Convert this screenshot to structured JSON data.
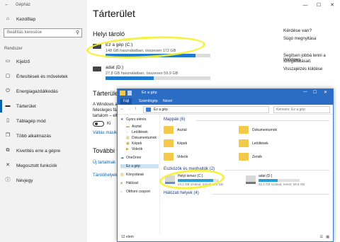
{
  "window": {
    "title": "Gépház"
  },
  "sidebar": {
    "home_label": "Kezdőlap",
    "search_placeholder": "Beállítás keresése",
    "section_label": "Rendszer",
    "items": [
      {
        "label": "Kijelző",
        "icon": "display-icon"
      },
      {
        "label": "Értesítések és műveletek",
        "icon": "notification-icon"
      },
      {
        "label": "Energiagazdálkodás",
        "icon": "power-icon"
      },
      {
        "label": "Tárterület",
        "icon": "storage-icon",
        "selected": true
      },
      {
        "label": "Táblagép mód",
        "icon": "tablet-icon"
      },
      {
        "label": "Több alkalmazás",
        "icon": "multitask-icon"
      },
      {
        "label": "Kivetítés erre a gépre",
        "icon": "project-icon"
      },
      {
        "label": "Megosztott funkciók",
        "icon": "shared-icon"
      },
      {
        "label": "Névjegy",
        "icon": "info-icon"
      }
    ]
  },
  "main": {
    "title": "Tárterület",
    "local_heading": "Helyi tároló",
    "drives": [
      {
        "name": "Ez a gép (C:)",
        "usage": "148 GB használatban, összesen 172 GB",
        "fill": 0.86
      },
      {
        "name": "adat (D:)",
        "usage": "27,8 GB használatban, összesen 59,9 GB",
        "fill": 0.46
      }
    ],
    "sense_heading": "Tárterület-",
    "sense_text_1": "A Windows au",
    "sense_text_2": "felesleges fájl",
    "sense_text_3": "tartalom – elt",
    "toggle_label": "Ki",
    "sense_link": "Váltás másik tárt",
    "more_heading": "További tár",
    "more_link_1": "Új tartalmak me",
    "more_link_2": "Tárolóhelyek ke"
  },
  "right_panel": {
    "question": "Kérdése van?",
    "help_link": "Súgó megnyitása",
    "improve_text_1": "Segítsen jobbá tenni a Windows",
    "improve_text_2": "szolgáltatásait.",
    "feedback_link": "Visszajelzés küldése"
  },
  "explorer": {
    "title": "Ez a gép",
    "tabs": [
      "Fájl",
      "Számítógép",
      "Nézet"
    ],
    "breadcrumb": "Ez a gép",
    "search_placeholder": "Keresés: Ez a gép",
    "tree": [
      {
        "label": "Gyors elérés",
        "icon": "star-icon"
      },
      {
        "label": "Asztal",
        "icon": "desktop-icon"
      },
      {
        "label": "Letöltések",
        "icon": "download-icon"
      },
      {
        "label": "Dokumentumok",
        "icon": "document-icon"
      },
      {
        "label": "Képek",
        "icon": "pictures-icon"
      },
      {
        "label": "Videók",
        "icon": "video-icon"
      },
      {
        "label": "OneDrive",
        "icon": "cloud-icon"
      },
      {
        "label": "Ez a gép",
        "icon": "computer-icon",
        "selected": true
      },
      {
        "label": "Könyvtárak",
        "icon": "library-icon"
      },
      {
        "label": "Hálózat",
        "icon": "network-icon"
      },
      {
        "label": "Otthoni csoport",
        "icon": "homegroup-icon"
      }
    ],
    "folders_heading": "Mappák (6)",
    "folders": [
      "Asztal",
      "Dokumentumok",
      "Képek",
      "Letöltések",
      "Videók",
      "Zenék"
    ],
    "devices_heading": "Eszközök és meghajtók (2)",
    "devices": [
      {
        "name": "Helyi lemez (C:)",
        "free": "24,1 GB szabad, méret: 172 GB",
        "fill": 0.86
      },
      {
        "name": "adat (D:)",
        "free": "32,1 GB szabad, méret: 59,9 GB",
        "fill": 0.46
      }
    ],
    "network_heading": "Hálózati helyek (4)",
    "status": "12 elem"
  },
  "colors": {
    "accent": "#0063b1",
    "bar_used": "#1e7bd1",
    "highlight": "#f5f12a",
    "folder": "#f3c94a"
  }
}
